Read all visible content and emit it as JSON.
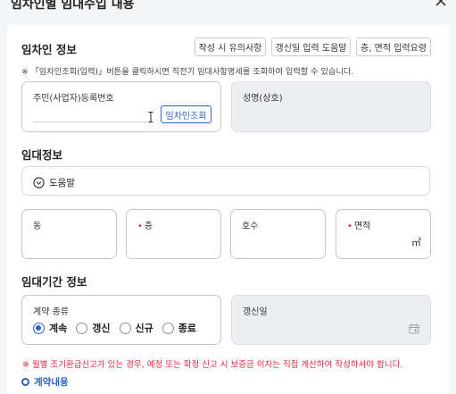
{
  "dialog": {
    "title": "임차인별 임대수입 내용",
    "close_icon": "close-icon"
  },
  "tenant": {
    "section_title": "임차인 정보",
    "buttons": {
      "notes": "작성 시 유의사항",
      "renewal_help": "갱신일 입력 도움말",
      "floor_area_help": "층, 면적 입력요령"
    },
    "note": "※ 「임차인조회(입력)」버튼을 클릭하시면 직전기 임대사항명세를 조회하여 입력할 수 있습니다.",
    "id_field": {
      "label": "주민(사업자)등록번호",
      "value": "",
      "button": "임차인조회"
    },
    "name_field": {
      "label": "성명(상호)",
      "value": ""
    }
  },
  "lease": {
    "section_title": "임대정보",
    "help_label": "도움말",
    "help_icon": "chevron-down-circle-icon",
    "fields": {
      "dong": {
        "label": "동",
        "value": ""
      },
      "floor": {
        "label": "층",
        "required": true,
        "value": ""
      },
      "room": {
        "label": "호수",
        "value": ""
      },
      "area": {
        "label": "면적",
        "required": true,
        "unit": "㎡",
        "value": ""
      }
    }
  },
  "period": {
    "section_title": "임대기간 정보",
    "contract_type": {
      "label": "계약 종류",
      "options": [
        "계속",
        "갱신",
        "신규",
        "종료"
      ],
      "selected": "계속"
    },
    "renewal_date": {
      "label": "갱신일",
      "value": "",
      "icon": "calendar-icon"
    }
  },
  "warning": "※ 월별 조기환급신고가 있는 경우, 예정 또는 확정 신고 시 보증금 이자는 직접 계산하여 작성하셔야 합니다.",
  "contract_link": "계약내용",
  "colors": {
    "accent": "#2b62c5",
    "required": "#e0263a",
    "warning": "#e0263a"
  }
}
